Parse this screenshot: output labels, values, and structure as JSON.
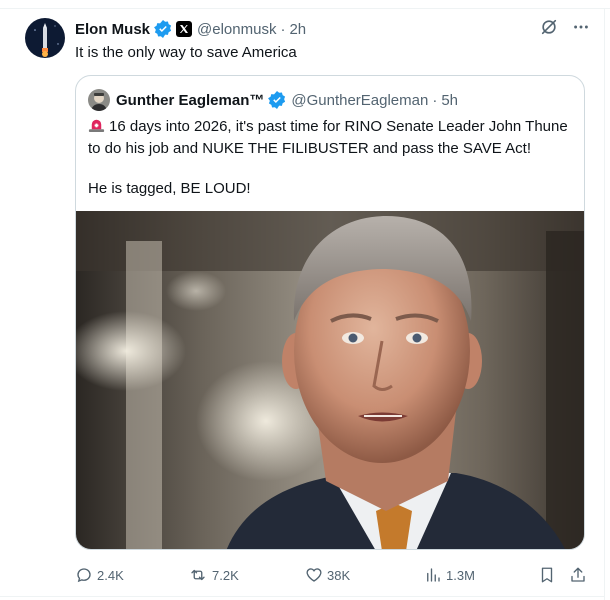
{
  "tweet": {
    "author_name": "Elon Musk",
    "handle": "@elonmusk",
    "separator": "·",
    "time": "2h",
    "text": "It is the only way to save America"
  },
  "quoted": {
    "author_name": "Gunther Eagleman™",
    "handle": "@GuntherEagleman",
    "separator": "·",
    "time": "5h",
    "line1": "16 days into 2026, it's past time for RINO Senate Leader John Thune to do his job and NUKE THE FILIBUSTER and pass the SAVE Act!",
    "line2": "He is tagged,  BE LOUD!"
  },
  "metrics": {
    "replies": "2.4K",
    "reposts": "7.2K",
    "likes": "38K",
    "views": "1.3M"
  },
  "icons": {
    "verified": "verified-badge-icon",
    "affiliate": "x-affiliate-icon",
    "grok": "grok-icon",
    "more": "more-icon",
    "siren": "siren-emoji-icon",
    "reply": "reply-icon",
    "repost": "repost-icon",
    "like": "heart-icon",
    "views": "views-icon",
    "bookmark": "bookmark-icon",
    "share": "share-icon"
  },
  "colors": {
    "accent": "#1d9bf0",
    "text": "#0f1419",
    "secondary": "#536471",
    "border": "#cfd9de"
  }
}
